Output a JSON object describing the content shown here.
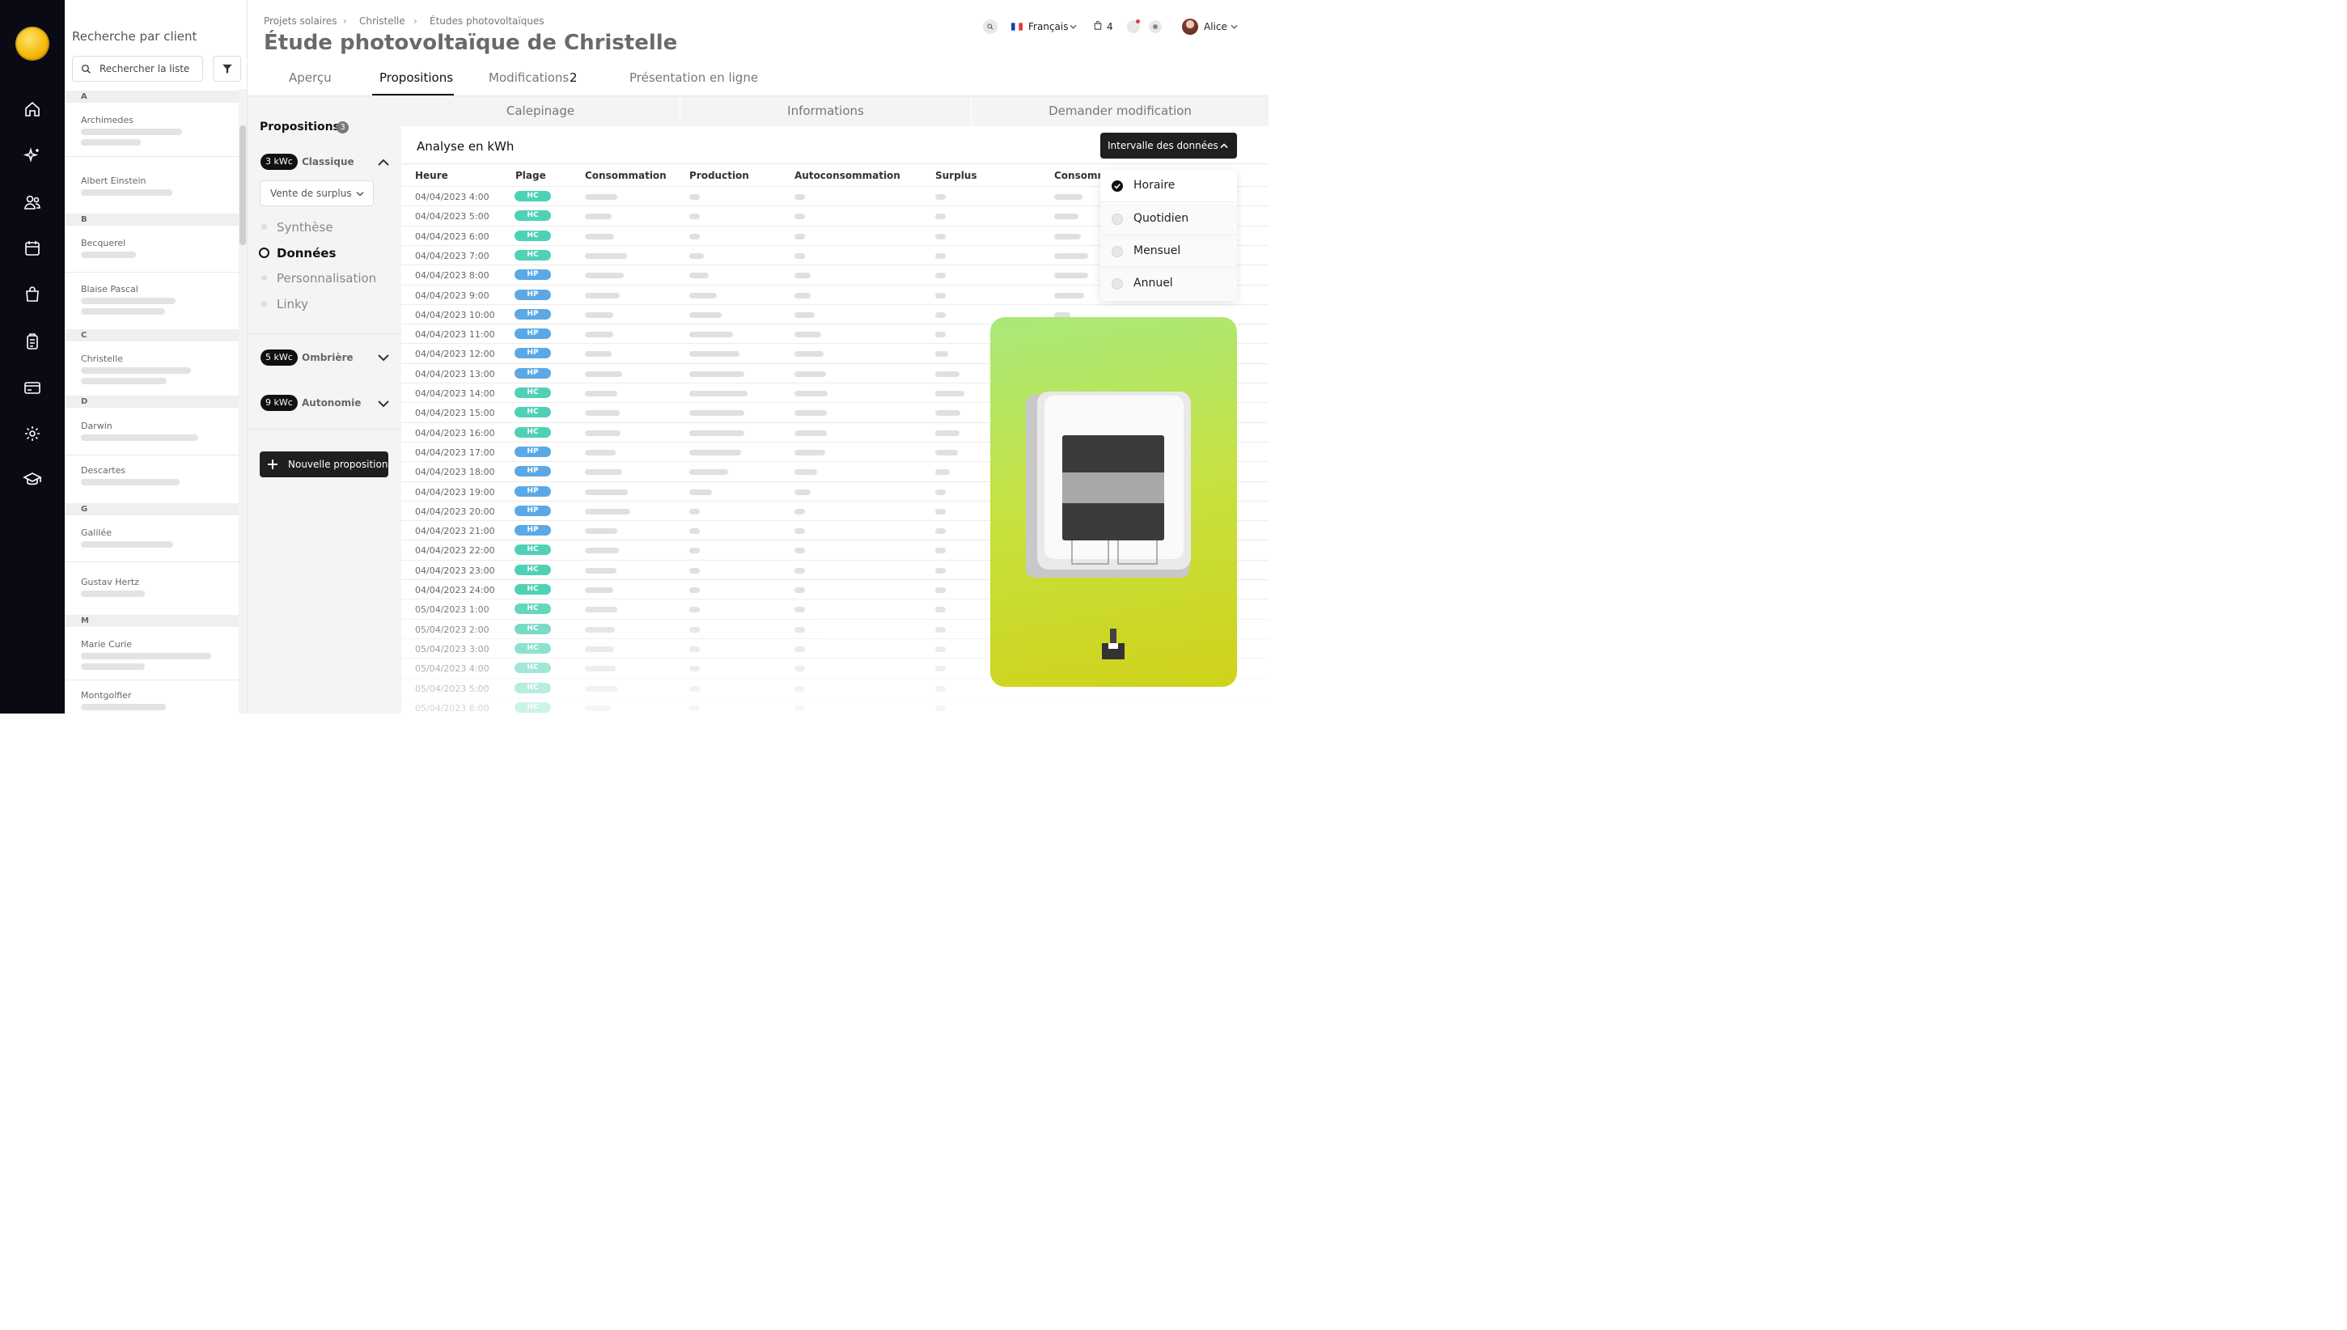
{
  "header": {
    "breadcrumb": [
      "Projets solaires",
      "Christelle",
      "Études photovoltaïques"
    ],
    "title": "Étude photovoltaïque de Christelle",
    "language": "Français",
    "cart_count": "4",
    "user_name": "Alice"
  },
  "tabs": {
    "apercu": "Aperçu",
    "propositions": "Propositions",
    "modifications": "Modifications",
    "modifications_count": "2",
    "presentation": "Présentation en ligne"
  },
  "client_list": {
    "heading": "Recherche par client",
    "search_placeholder": "Rechercher la liste",
    "groups": [
      {
        "letter": "A",
        "clients": [
          "Archimedes",
          "Albert Einstein"
        ]
      },
      {
        "letter": "B",
        "clients": [
          "Becquerel",
          "Blaise Pascal"
        ]
      },
      {
        "letter": "C",
        "clients": [
          "Christelle"
        ]
      },
      {
        "letter": "D",
        "clients": [
          "Darwin",
          "Descartes"
        ]
      },
      {
        "letter": "G",
        "clients": [
          "Galilée",
          "Gustav Hertz"
        ]
      },
      {
        "letter": "M",
        "clients": [
          "Marie Curie",
          "Montgolfier"
        ]
      }
    ]
  },
  "proposals": {
    "heading": "Propositions",
    "count": "3",
    "items": [
      {
        "power": "3 kWc",
        "name": "Classique"
      },
      {
        "power": "5 kWc",
        "name": "Ombrière"
      },
      {
        "power": "9 kWc",
        "name": "Autonomie"
      }
    ],
    "select_value": "Vente de surplus",
    "steps": [
      "Synthèse",
      "Données",
      "Personnalisation",
      "Linky"
    ],
    "active_step": "Données",
    "new_button": "Nouvelle proposition"
  },
  "subtabs": [
    "Calepinage",
    "Informations",
    "Demander modification"
  ],
  "analysis": {
    "title": "Analyse en kWh",
    "interval_button": "Intervalle des données",
    "interval_options": [
      "Horaire",
      "Quotidien",
      "Mensuel",
      "Annuel"
    ],
    "selected_interval": "Horaire",
    "columns": [
      "Heure",
      "Plage",
      "Consommation",
      "Production",
      "Autoconsommation",
      "Surplus",
      "Consomm"
    ],
    "rows": [
      [
        "04/04/2023 4:00",
        "HC"
      ],
      [
        "04/04/2023 5:00",
        "HC"
      ],
      [
        "04/04/2023 6:00",
        "HC"
      ],
      [
        "04/04/2023 7:00",
        "HC"
      ],
      [
        "04/04/2023 8:00",
        "HP"
      ],
      [
        "04/04/2023 9:00",
        "HP"
      ],
      [
        "04/04/2023 10:00",
        "HP"
      ],
      [
        "04/04/2023 11:00",
        "HP"
      ],
      [
        "04/04/2023 12:00",
        "HP"
      ],
      [
        "04/04/2023 13:00",
        "HP"
      ],
      [
        "04/04/2023 14:00",
        "HC"
      ],
      [
        "04/04/2023 15:00",
        "HC"
      ],
      [
        "04/04/2023 16:00",
        "HC"
      ],
      [
        "04/04/2023 17:00",
        "HP"
      ],
      [
        "04/04/2023 18:00",
        "HP"
      ],
      [
        "04/04/2023 19:00",
        "HP"
      ],
      [
        "04/04/2023 20:00",
        "HP"
      ],
      [
        "04/04/2023 21:00",
        "HP"
      ],
      [
        "04/04/2023 22:00",
        "HC"
      ],
      [
        "04/04/2023 23:00",
        "HC"
      ],
      [
        "04/04/2023 24:00",
        "HC"
      ],
      [
        "05/04/2023 1:00",
        "HC"
      ],
      [
        "05/04/2023 2:00",
        "HC"
      ],
      [
        "05/04/2023 3:00",
        "HC"
      ],
      [
        "05/04/2023 4:00",
        "HC"
      ],
      [
        "05/04/2023 5:00",
        "HC"
      ],
      [
        "05/04/2023 6:00",
        "HC"
      ]
    ],
    "plage_colors": {
      "HC": "#4fd1b5",
      "HP": "#5aa9e6"
    }
  },
  "colors": {
    "accent": "#111111",
    "card_top": "#a9e97a",
    "card_bottom": "#cfd21a"
  }
}
